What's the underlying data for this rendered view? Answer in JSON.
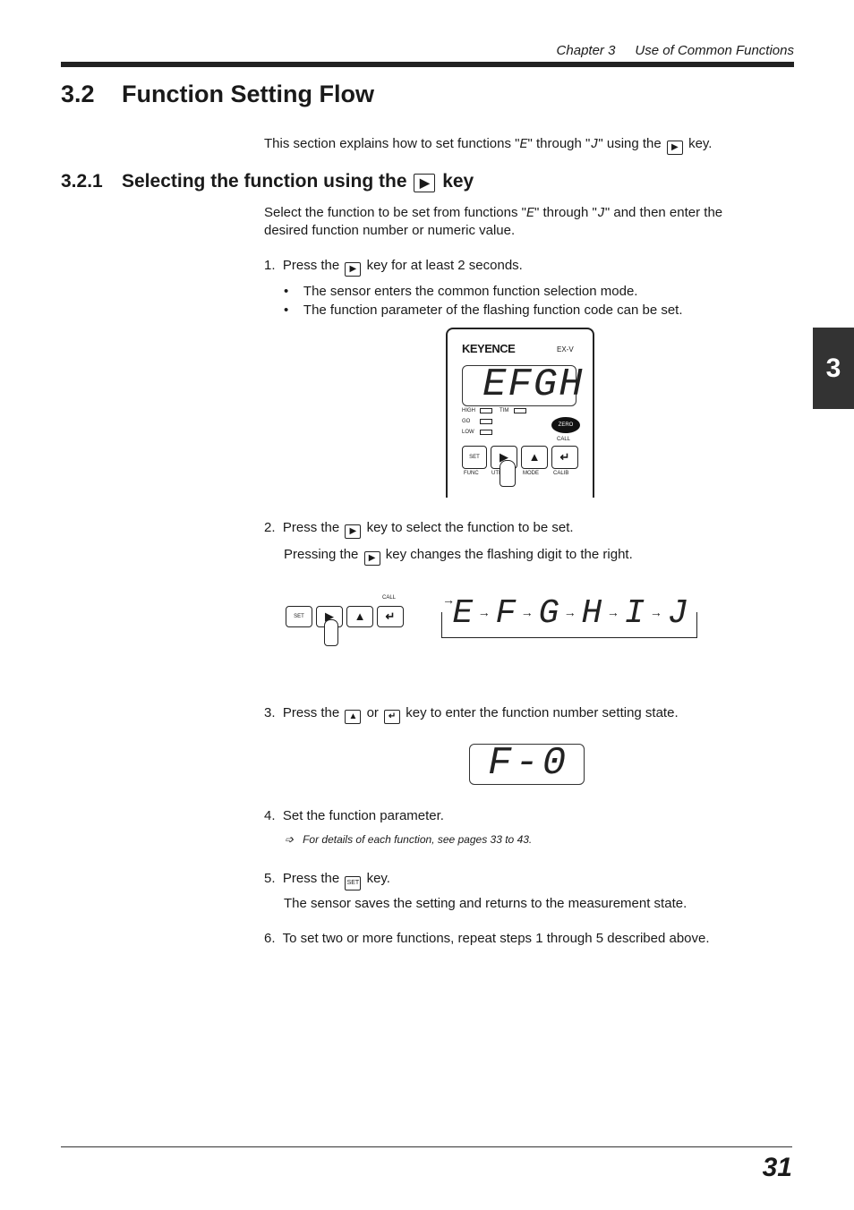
{
  "header": {
    "chapter": "Chapter 3",
    "chapter_title": "Use of Common Functions"
  },
  "section": {
    "number": "3.2",
    "title": "Function Setting Flow"
  },
  "intro": {
    "before": "This section explains how to set functions \"",
    "f1": "E",
    "mid": "\" through \"",
    "f2": "J",
    "after": "\" using the",
    "end": "key."
  },
  "subsection": {
    "number": "3.2.1",
    "title_before": "Selecting the function using the",
    "title_after": "key"
  },
  "sub_intro": {
    "line1_a": "Select the function to be set from functions \"",
    "f1": "E",
    "line1_b": "\" through \"",
    "f2": "J",
    "line1_c": "\" and then enter the",
    "line2": "desired function number or numeric value."
  },
  "steps": [
    {
      "n": "1.",
      "a": "Press the",
      "b": "key for at least 2 seconds.",
      "bullets": [
        "The sensor enters the common function selection mode.",
        "The function parameter of the flashing function code can be set."
      ]
    },
    {
      "n": "2.",
      "a": "Press the",
      "b": "key to select the function to be set.",
      "sub_a": "Pressing the",
      "sub_b": "key changes the flashing digit to the right."
    },
    {
      "n": "3.",
      "a": "Press the",
      "or": "or",
      "b": "key to enter the function number setting state."
    },
    {
      "n": "4.",
      "a": "Set the function parameter.",
      "note": "For details of each function, see pages 33 to 43."
    },
    {
      "n": "5.",
      "a": "Press the",
      "b": "key.",
      "sub": "The sensor saves the setting and returns to the measurement state."
    },
    {
      "n": "6.",
      "a": "To set two or more functions, repeat steps 1 through 5 described above."
    }
  ],
  "keys": {
    "right": "▶",
    "up": "▲",
    "enter": "↵",
    "set": "SET"
  },
  "device": {
    "brand": "KEYENCE",
    "model": "EX-V",
    "display": "EFGH",
    "leds": [
      "HIGH",
      "GO",
      "LOW",
      "TIM"
    ],
    "zero": "ZERO",
    "call": "CALL",
    "labels": [
      "FUNC",
      "UTIL",
      "MODE",
      "CALIB"
    ]
  },
  "flow": {
    "codes": [
      "E",
      "F",
      "G",
      "H",
      "I",
      "J"
    ],
    "call": "CALL"
  },
  "display2": "F-0",
  "side_tab": "3",
  "page_number": "31",
  "icons": [
    "right-arrow-key-icon",
    "up-arrow-key-icon",
    "enter-key-icon",
    "set-key-icon",
    "hand-pointer-icon",
    "reference-arrow-icon"
  ]
}
